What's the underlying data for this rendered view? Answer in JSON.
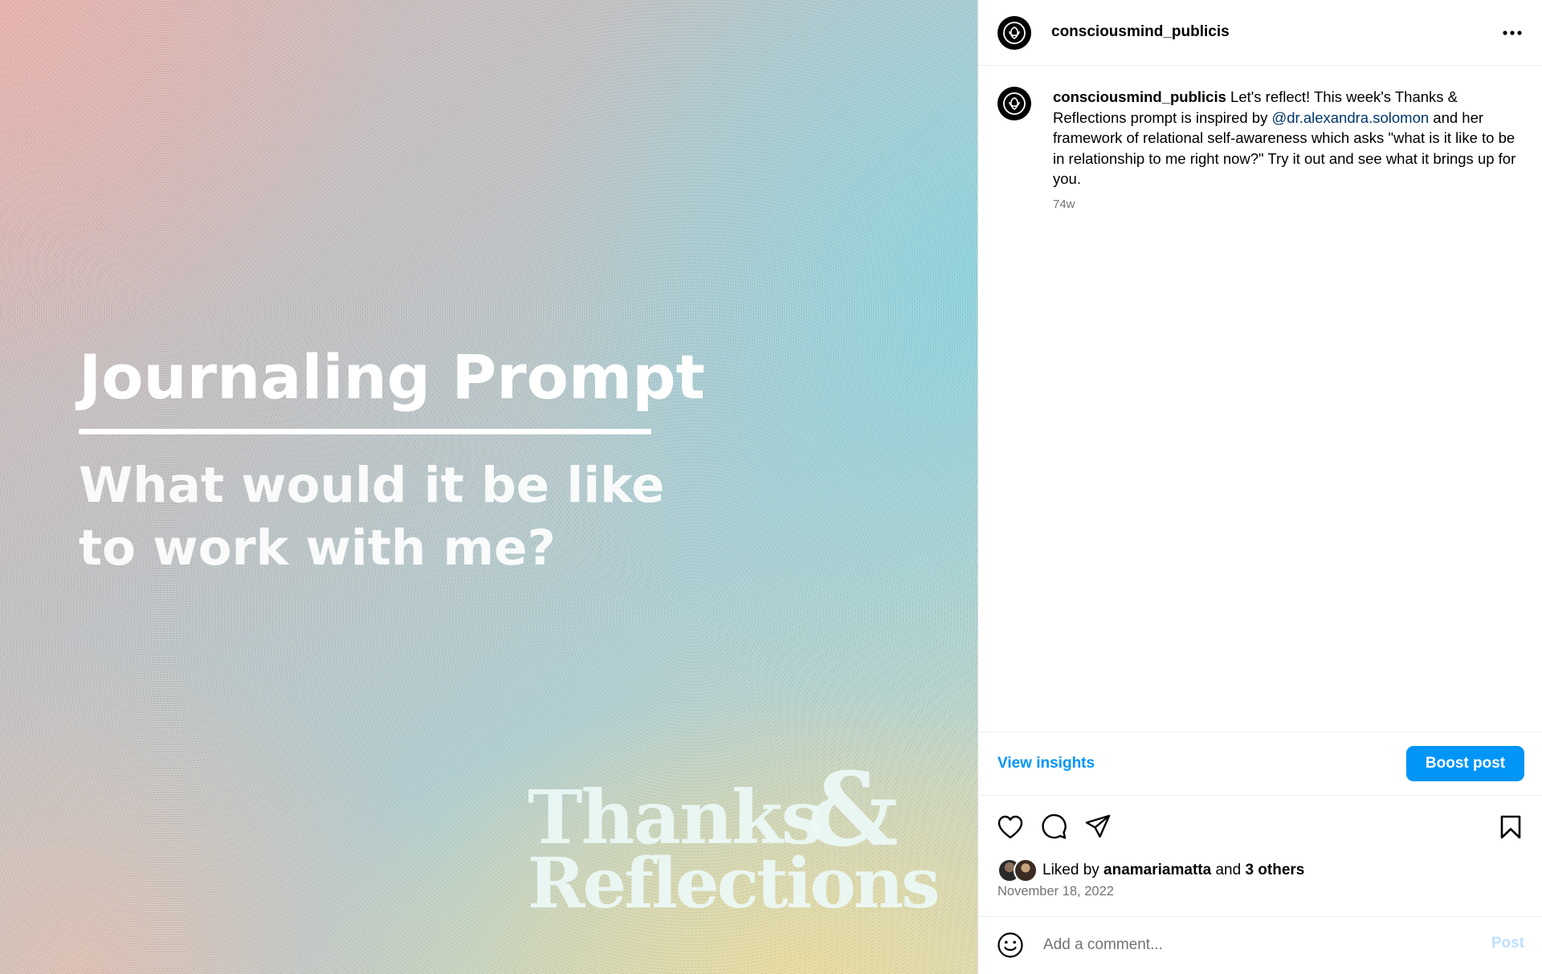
{
  "post_image": {
    "title": "Journaling Prompt",
    "question": "What would it be like to work with me?",
    "brand_line1": "Thanks",
    "brand_amp": "&",
    "brand_line2": "Reflections"
  },
  "header": {
    "username": "consciousmind_publicis",
    "more_icon": "more-horizontal-icon"
  },
  "caption": {
    "username": "consciousmind_publicis",
    "text_before": " Let's reflect! This week's Thanks & Reflections prompt is inspired by ",
    "mention": "@dr.alexandra.solomon",
    "text_after": " and her framework of relational self-awareness which asks \"what is it like to be in relationship to me right now?\" Try it out and see what it brings up for you.",
    "time": "74w"
  },
  "insights": {
    "view_label": "View insights",
    "boost_label": "Boost post"
  },
  "actions": {
    "like_icon": "heart-icon",
    "comment_icon": "comment-icon",
    "share_icon": "send-icon",
    "save_icon": "bookmark-icon"
  },
  "likes": {
    "prefix": "Liked by ",
    "user": "anamariamatta",
    "middle": " and ",
    "others": "3 others"
  },
  "date": "November 18, 2022",
  "comment": {
    "placeholder": "Add a comment...",
    "post_label": "Post"
  },
  "colors": {
    "accent": "#0095f6",
    "mention": "#00376b",
    "muted": "#737373",
    "post_disabled": "#c0dffd"
  }
}
